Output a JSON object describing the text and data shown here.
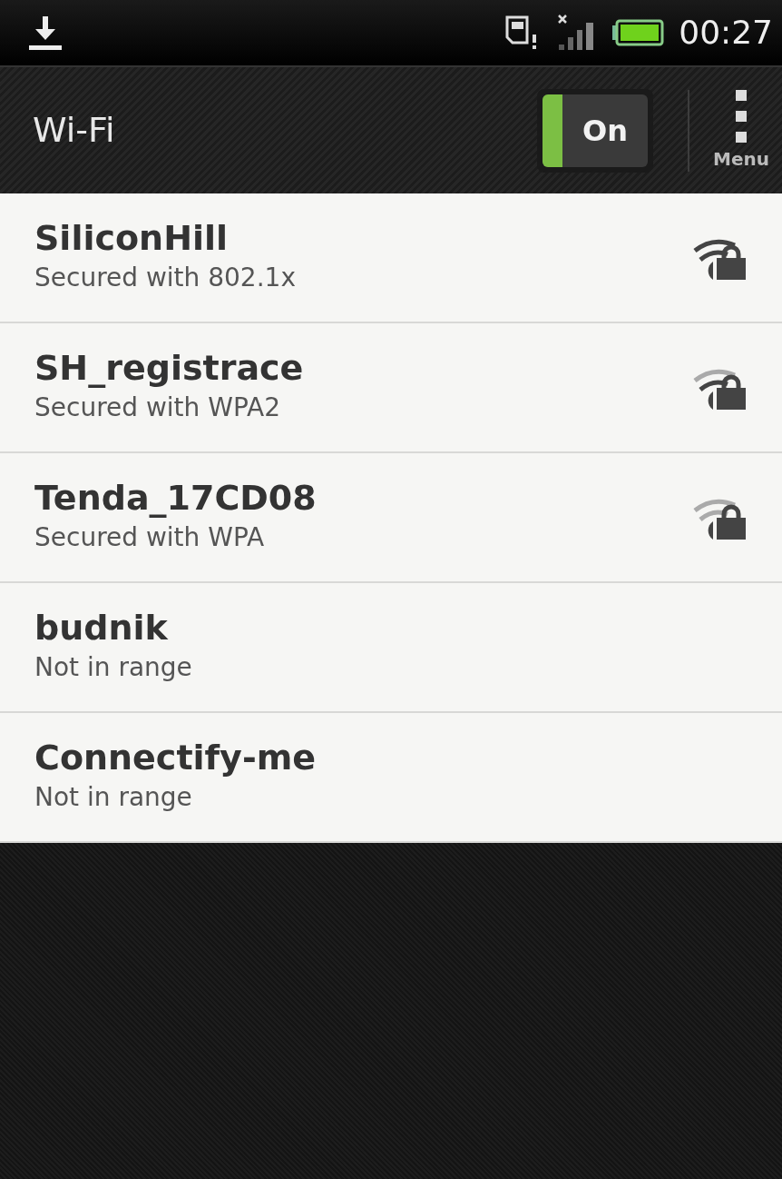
{
  "status_bar": {
    "time": "00:27"
  },
  "header": {
    "title": "Wi-Fi",
    "toggle": {
      "label": "On",
      "on": true
    },
    "menu_label": "Menu"
  },
  "networks": [
    {
      "name": "SiliconHill",
      "status": "Secured with 802.1x",
      "kind": "strong"
    },
    {
      "name": "SH_registrace",
      "status": "Secured with WPA2",
      "kind": "medium"
    },
    {
      "name": "Tenda_17CD08",
      "status": "Secured with WPA",
      "kind": "weak"
    },
    {
      "name": "budnik",
      "status": "Not in range",
      "kind": "absent"
    },
    {
      "name": "Connectify-me",
      "status": "Not in range",
      "kind": "absent"
    }
  ]
}
